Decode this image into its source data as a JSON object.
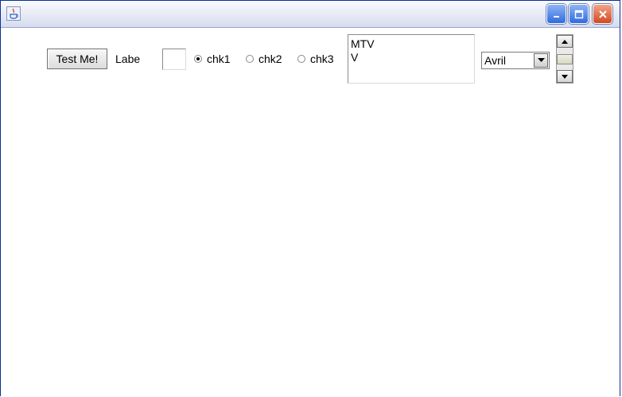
{
  "window": {
    "icons": {
      "app": "java-icon",
      "minimize": "minimize-icon",
      "maximize": "maximize-icon",
      "close": "close-icon"
    }
  },
  "controls": {
    "button_label": "Test Me!",
    "label_text": "Labe",
    "text_field_value": "",
    "radios": [
      {
        "label": "chk1",
        "checked": true
      },
      {
        "label": "chk2",
        "checked": false
      },
      {
        "label": "chk3",
        "checked": false
      }
    ],
    "text_area_lines": [
      "MTV",
      "V"
    ],
    "combo_selected": "Avril"
  },
  "colors": {
    "title_start": "#fafbfd",
    "title_end": "#d7dcef",
    "close_button": "#d4481f",
    "minmax_button": "#2f6be0"
  }
}
